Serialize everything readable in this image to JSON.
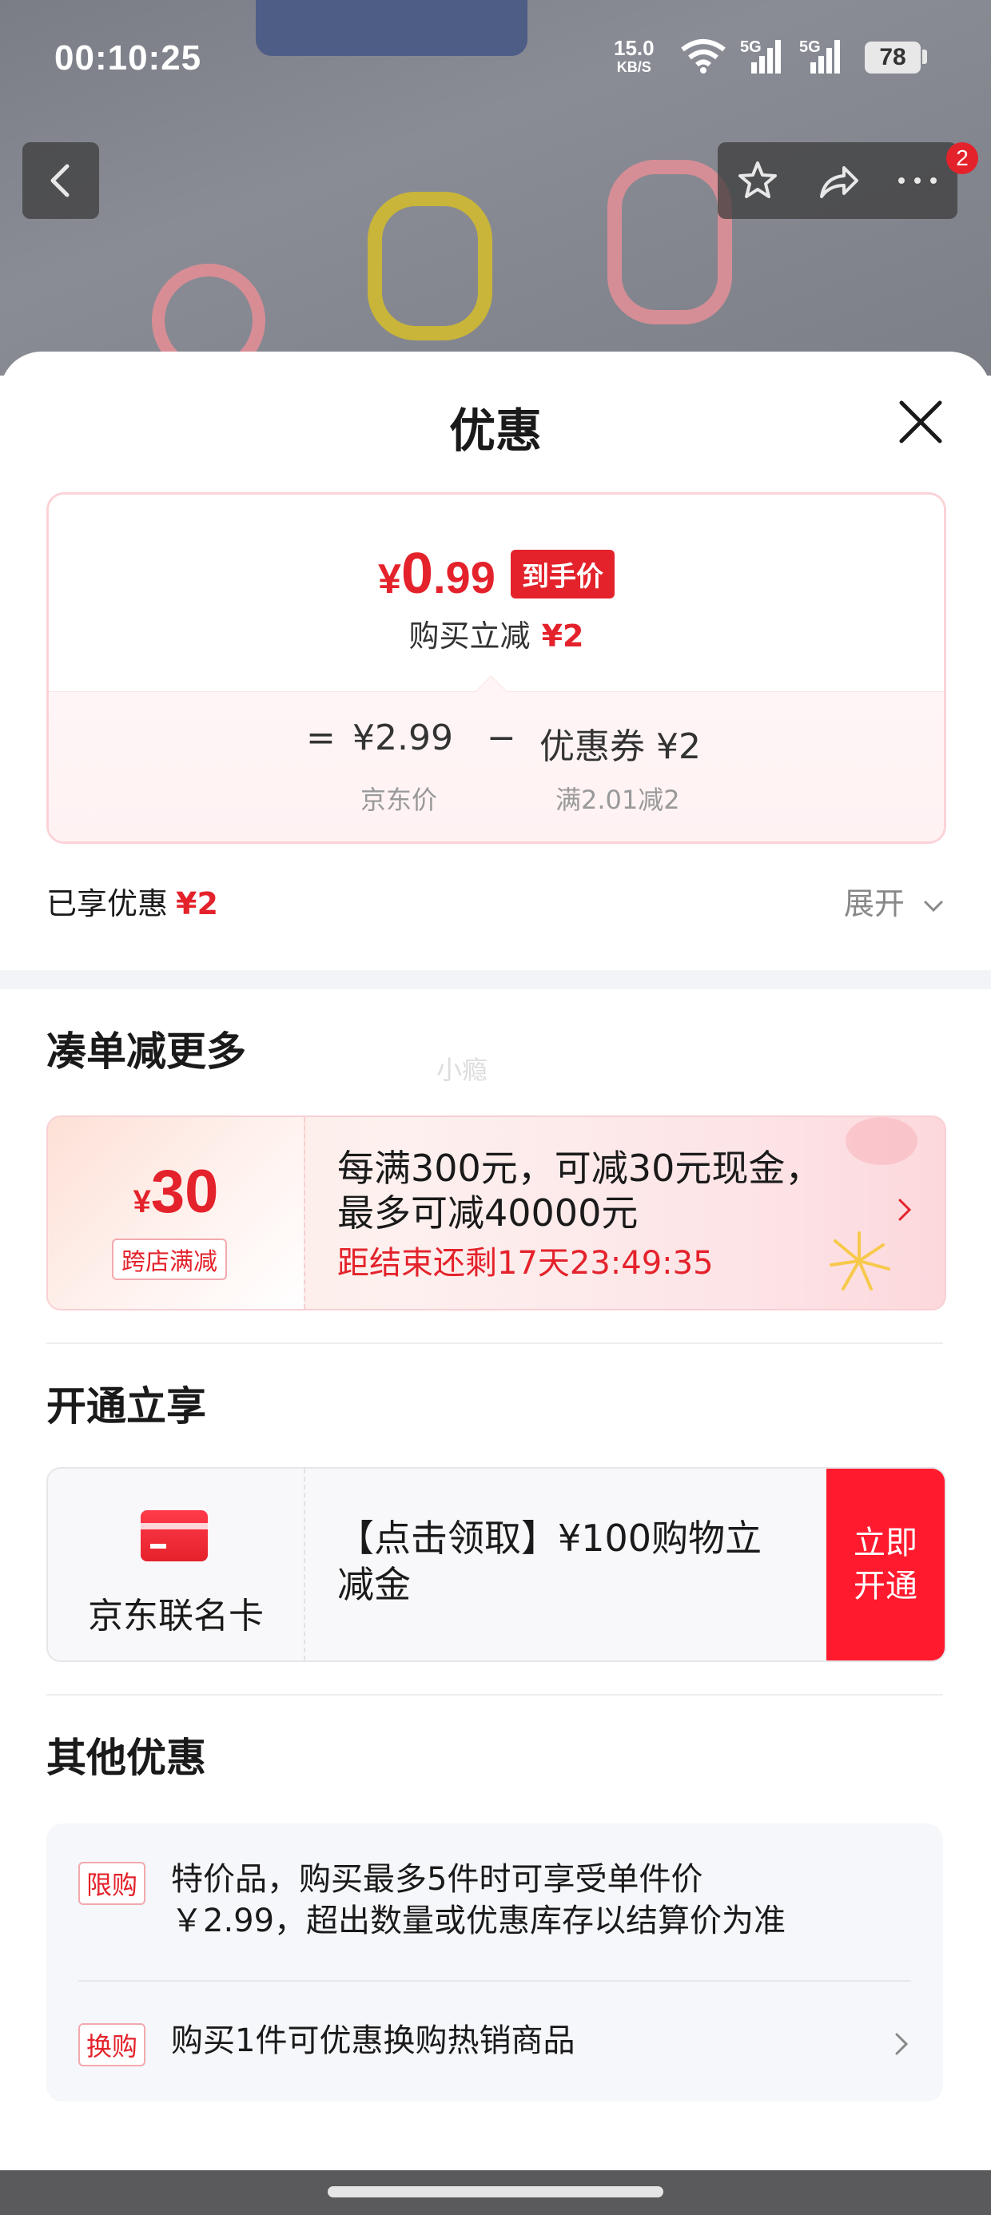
{
  "status_bar": {
    "time": "00:10:25",
    "net_speed": "15.0",
    "net_unit": "KB/S",
    "signal1": "5G",
    "signal2": "5G",
    "battery": "78"
  },
  "nav": {
    "badge_count": "2"
  },
  "sheet": {
    "title": "优惠"
  },
  "price_card": {
    "price_yen": "¥",
    "price_int": "0",
    "price_dec": ".99",
    "price_tag": "到手价",
    "instant_label": "购买立减",
    "instant_amount": "¥2",
    "eq": "=",
    "jd_price": "¥2.99",
    "minus": "−",
    "coupon": "优惠券 ¥2",
    "jd_price_label": "京东价",
    "coupon_label": "满2.01减2"
  },
  "enjoyed": {
    "label": "已享优惠",
    "amount": "¥2",
    "expand_label": "展开"
  },
  "section_more": {
    "title": "凑单减更多",
    "watermark": "小瘾",
    "promo": {
      "yen": "¥",
      "amount": "30",
      "tag": "跨店满减",
      "text_line1": "每满300元，可减30元现金，",
      "text_line2": "最多可减40000元",
      "countdown": "距结束还剩17天23:49:35"
    }
  },
  "section_open": {
    "title": "开通立享",
    "card_name": "京东联名卡",
    "text_line1": "【点击领取】¥100购物立",
    "text_line2": "减金",
    "button_line1": "立即",
    "button_line2": "开通"
  },
  "section_other": {
    "title": "其他优惠",
    "items": [
      {
        "tag": "限购",
        "line1": "特价品，购买最多5件时可享受单件价",
        "line2": "￥2.99，超出数量或优惠库存以结算价为准"
      },
      {
        "tag": "换购",
        "line1": "购买1件可优惠换购热销商品"
      }
    ]
  },
  "colors": {
    "accent_red": "#e4222b",
    "open_button": "#ff1a2e"
  }
}
